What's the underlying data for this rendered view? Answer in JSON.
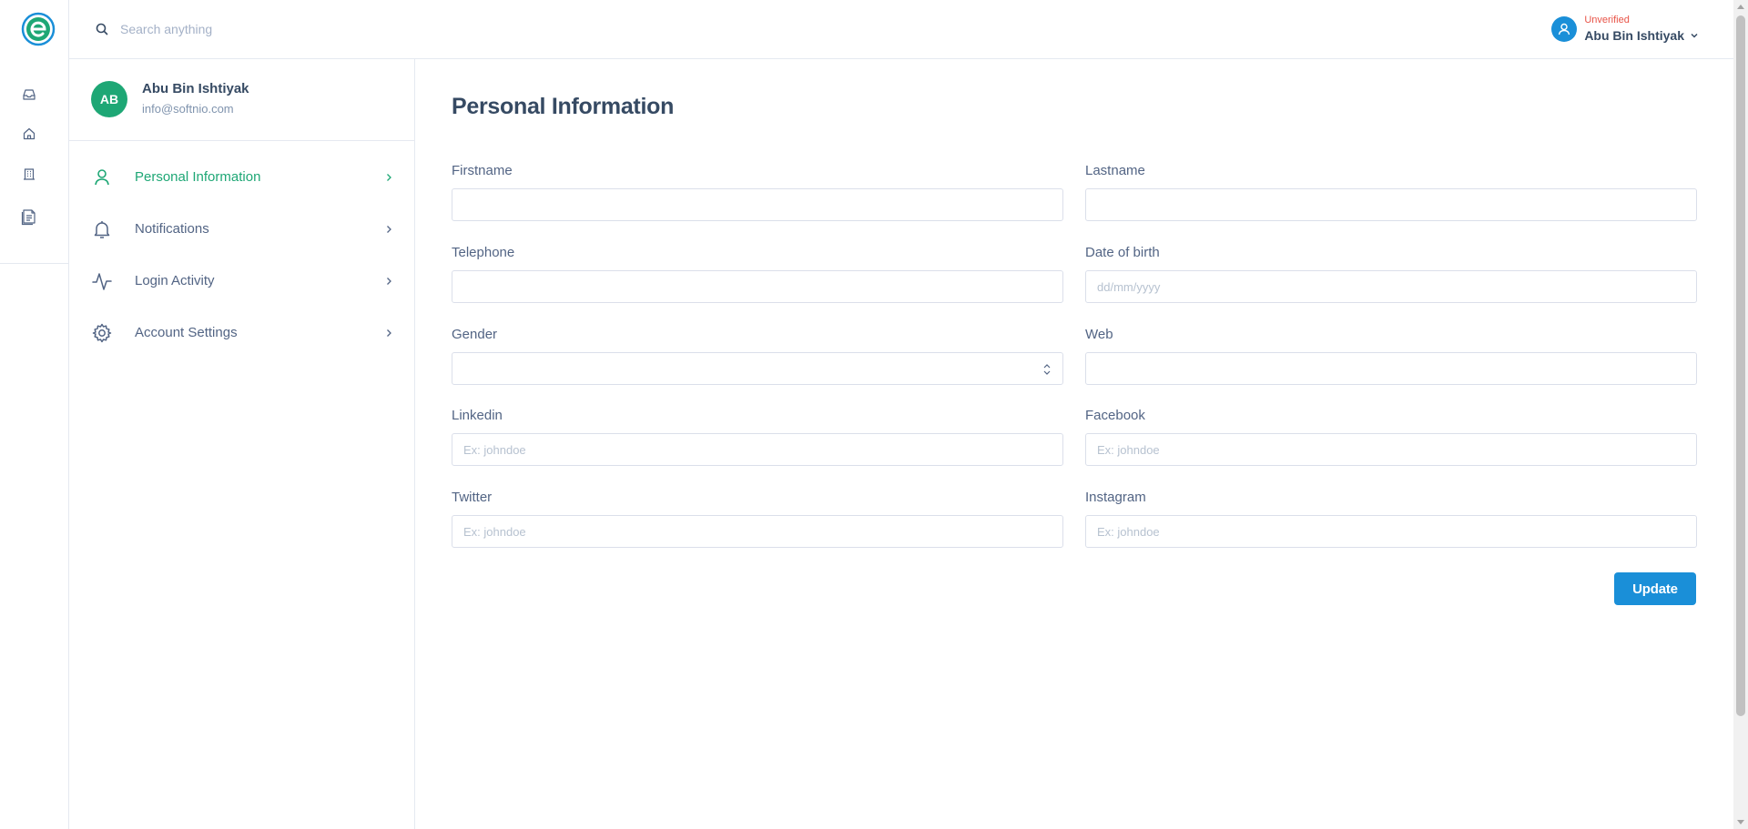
{
  "search": {
    "placeholder": "Search anything"
  },
  "user_menu": {
    "status": "Unverified",
    "name": "Abu Bin Ishtiyak"
  },
  "profile": {
    "initials": "AB",
    "name": "Abu Bin Ishtiyak",
    "email": "info@softnio.com"
  },
  "menu": [
    {
      "label": "Personal Information",
      "icon": "user-icon",
      "active": true
    },
    {
      "label": "Notifications",
      "icon": "bell-icon",
      "active": false
    },
    {
      "label": "Login Activity",
      "icon": "activity-icon",
      "active": false
    },
    {
      "label": "Account Settings",
      "icon": "gear-icon",
      "active": false
    }
  ],
  "rail_icons": [
    "inbox-icon",
    "home-icon",
    "building-icon",
    "document-icon"
  ],
  "form": {
    "title": "Personal Information",
    "fields": {
      "firstname": {
        "label": "Firstname",
        "value": "",
        "placeholder": ""
      },
      "lastname": {
        "label": "Lastname",
        "value": "",
        "placeholder": ""
      },
      "telephone": {
        "label": "Telephone",
        "value": "",
        "placeholder": ""
      },
      "dob": {
        "label": "Date of birth",
        "value": "",
        "placeholder": "dd/mm/yyyy"
      },
      "gender": {
        "label": "Gender",
        "value": ""
      },
      "web": {
        "label": "Web",
        "value": "",
        "placeholder": ""
      },
      "linkedin": {
        "label": "Linkedin",
        "value": "",
        "placeholder": "Ex: johndoe"
      },
      "facebook": {
        "label": "Facebook",
        "value": "",
        "placeholder": "Ex: johndoe"
      },
      "twitter": {
        "label": "Twitter",
        "value": "",
        "placeholder": "Ex: johndoe"
      },
      "instagram": {
        "label": "Instagram",
        "value": "",
        "placeholder": "Ex: johndoe"
      }
    },
    "submit_label": "Update"
  },
  "colors": {
    "brand_green": "#1ea775",
    "primary_blue": "#1a8fd8",
    "danger": "#e85347"
  }
}
